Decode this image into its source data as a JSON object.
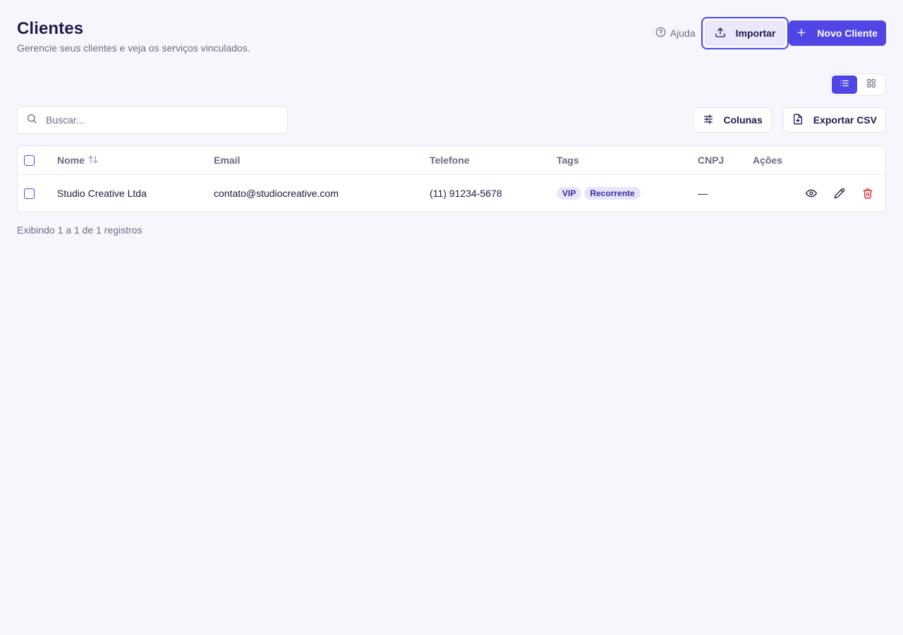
{
  "header": {
    "title": "Clientes",
    "subtitle": "Gerencie seus clientes e veja os serviços vinculados."
  },
  "top_actions": {
    "help_label": "Ajuda",
    "import_label": "Importar",
    "new_label": "Novo Cliente"
  },
  "view_toggle": {
    "active": "list"
  },
  "search": {
    "placeholder": "Buscar...",
    "value": ""
  },
  "toolbar": {
    "columns_label": "Colunas",
    "export_label": "Exportar CSV"
  },
  "table": {
    "columns": {
      "name": "Nome",
      "email": "Email",
      "phone": "Telefone",
      "tags": "Tags",
      "cnpj": "CNPJ",
      "actions": "Ações"
    },
    "rows": [
      {
        "name": "Studio Creative Ltda",
        "email": "contato@studiocreative.com",
        "phone": "(11) 91234-5678",
        "tags": [
          "VIP",
          "Recorrente"
        ],
        "cnpj": "—"
      }
    ]
  },
  "footer": {
    "info": "Exibindo 1 a 1 de 1 registros"
  },
  "colors": {
    "accent": "#4f46e5",
    "background": "#f8f6fd",
    "danger": "#dc2626"
  },
  "icons": {
    "help": "help-circle-icon",
    "import": "upload-icon",
    "new": "plus-icon",
    "list_view": "list-icon",
    "grid_view": "grid-icon",
    "search": "search-icon",
    "columns": "sliders-icon",
    "export": "file-download-icon",
    "sort": "sort-arrows-icon",
    "view": "eye-icon",
    "edit": "pencil-icon",
    "delete": "trash-icon"
  }
}
